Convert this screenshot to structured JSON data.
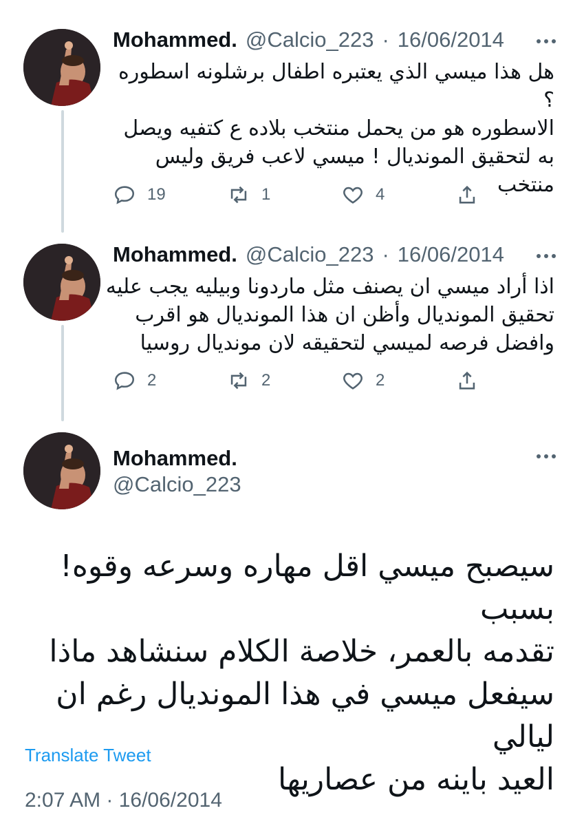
{
  "tweets": [
    {
      "name": "Mohammed.",
      "handle": "@Calcio_223",
      "sep": "·",
      "date": "16/06/2014",
      "text_lines": [
        "هل هذا ميسي الذي يعتبره اطفال برشلونه اسطوره ؟",
        "الاسطوره هو من يحمل منتخب بلاده ع كتفيه ويصل",
        "به لتحقيق المونديال ! ميسي لاعب فريق وليس",
        "منتخب"
      ],
      "replies": "19",
      "retweets": "1",
      "likes": "4"
    },
    {
      "name": "Mohammed.",
      "handle": "@Calcio_223",
      "sep": "·",
      "date": "16/06/2014",
      "text_lines": [
        "اذا أراد ميسي ان يصنف مثل ماردونا وبيليه يجب عليه",
        "تحقيق المونديال وأظن ان هذا المونديال هو اقرب",
        "وافضل فرصه لميسي لتحقيقه لان مونديال روسيا"
      ],
      "replies": "2",
      "retweets": "2",
      "likes": "2"
    }
  ],
  "main": {
    "name": "Mohammed.",
    "handle": "@Calcio_223",
    "text_lines": [
      "سيصبح ميسي اقل مهاره وسرعه وقوه! بسبب",
      "تقدمه بالعمر، خلاصة الكلام سنشاهد ماذا",
      "سيفعل ميسي في هذا المونديال رغم ان ليالي",
      "العيد باينه من عصاريها"
    ],
    "translate": "Translate Tweet",
    "timestamp": "2:07 AM · 16/06/2014"
  },
  "icons": {
    "reply": "reply-icon",
    "retweet": "retweet-icon",
    "like": "heart-icon",
    "share": "share-icon",
    "more": "more-dots-icon"
  },
  "colors": {
    "link": "#1d9bf0",
    "secondary": "#536471",
    "thread_line": "#cfd9de"
  }
}
